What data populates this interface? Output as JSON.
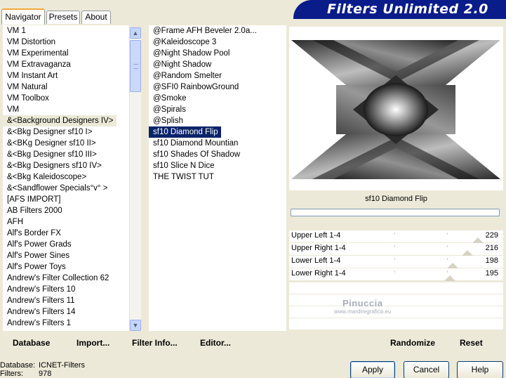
{
  "tabs": [
    {
      "label": "Navigator",
      "active": true
    },
    {
      "label": "Presets",
      "active": false
    },
    {
      "label": "About",
      "active": false
    }
  ],
  "banner": {
    "title": "Filters Unlimited 2.0",
    "color": "#0a1b8a"
  },
  "categories": [
    "VM 1",
    "VM Distortion",
    "VM Experimental",
    "VM Extravaganza",
    "VM Instant Art",
    "VM Natural",
    "VM Toolbox",
    "VM",
    "&<Background Designers IV>",
    "&<Bkg Designer sf10 I>",
    "&<BKg Designer sf10 II>",
    "&<Bkg Designer sf10 III>",
    "&<Bkg Designers sf10 IV>",
    "&<Bkg Kaleidoscope>",
    "&<Sandflower Specials°v° >",
    "[AFS IMPORT]",
    "AB Filters 2000",
    "AFH",
    "Alf's Border FX",
    "Alf's Power Grads",
    "Alf's Power Sines",
    "Alf's Power Toys",
    "Andrew's Filter Collection 62",
    "Andrew's Filters 10",
    "Andrew's Filters 11",
    "Andrew's Filters 14",
    "Andrew's Filters 1"
  ],
  "selected_category": "&<Background Designers IV>",
  "filters": [
    "@Frame AFH Beveler 2.0a...",
    "@Kaleidoscope 3",
    "@Night Shadow Pool",
    "@Night Shadow",
    "@Random Smelter",
    "@SFI0 RainbowGround",
    "@Smoke",
    "@Spirals",
    "@Splish",
    "sf10 Diamond Flip",
    "sf10 Diamond Mountian",
    "sf10 Shades Of Shadow",
    "sf10 Slice N Dice",
    "THE TWIST TUT"
  ],
  "selected_filter": "sf10 Diamond Flip",
  "filter_name": "sf10 Diamond Flip",
  "sliders": [
    {
      "label": "Upper Left 1-4",
      "value": "229",
      "level": 229
    },
    {
      "label": "Upper Right 1-4",
      "value": "216",
      "level": 216
    },
    {
      "label": "Lower Left 1-4",
      "value": "198",
      "level": 198
    },
    {
      "label": "Lower Right 1-4",
      "value": "195",
      "level": 195
    }
  ],
  "watermark": {
    "line1": "Pinuccia",
    "line2": "www.mardiregrafica.eu"
  },
  "bottom_buttons": {
    "database": "Database",
    "import": "Import...",
    "filter_info": "Filter Info...",
    "editor": "Editor...",
    "randomize": "Randomize",
    "reset": "Reset"
  },
  "status": {
    "database_label": "Database:",
    "database_value": "ICNET-Filters",
    "filters_label": "Filters:",
    "filters_value": "978"
  },
  "dialog_buttons": {
    "apply": "Apply",
    "cancel": "Cancel",
    "help": "Help"
  }
}
